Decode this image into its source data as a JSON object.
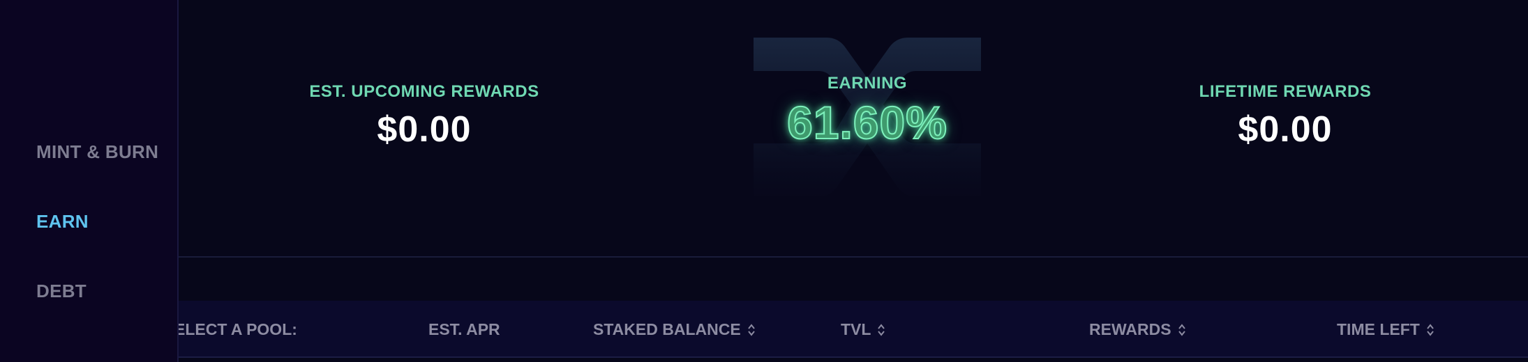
{
  "sidebar": {
    "items": [
      {
        "label": "MINT & BURN",
        "active": false
      },
      {
        "label": "EARN",
        "active": true
      },
      {
        "label": "DEBT",
        "active": false
      }
    ]
  },
  "stats": {
    "upcoming_rewards": {
      "label": "EST. UPCOMING REWARDS",
      "value": "$0.00"
    },
    "earning": {
      "label": "EARNING",
      "value": "61.60%"
    },
    "lifetime_rewards": {
      "label": "LIFETIME REWARDS",
      "value": "$0.00"
    }
  },
  "pool_table": {
    "columns": [
      {
        "label": "ELECT A POOL:",
        "sortable": false
      },
      {
        "label": "EST. APR",
        "sortable": false
      },
      {
        "label": "STAKED BALANCE",
        "sortable": true
      },
      {
        "label": "TVL",
        "sortable": true
      },
      {
        "label": "REWARDS",
        "sortable": true
      },
      {
        "label": "TIME LEFT",
        "sortable": true
      }
    ]
  },
  "icons": {
    "sort": "sort-icon",
    "brand": "synthetix-logo-icon"
  },
  "colors": {
    "background": "#07071a",
    "sidebar": "#0b0522",
    "accent_green": "#6fd8b2",
    "accent_blue": "#5fc4ef",
    "muted_text": "#8d8ca2"
  }
}
